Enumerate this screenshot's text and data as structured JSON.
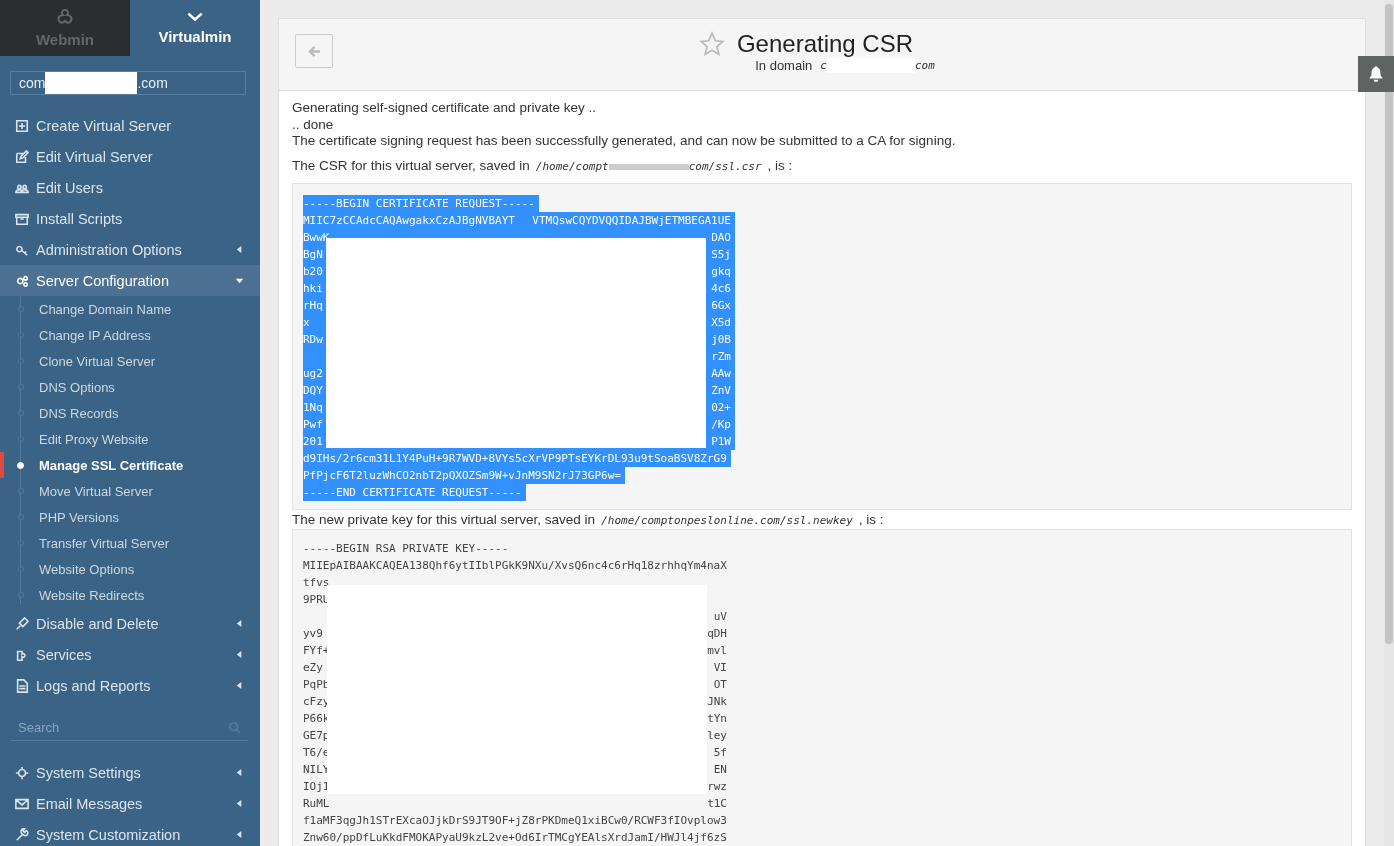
{
  "sidebar": {
    "tabs": [
      {
        "label": "Webmin",
        "selected": false
      },
      {
        "label": "Virtualmin",
        "selected": true
      }
    ],
    "domain": {
      "start": "com",
      "end": ".com"
    },
    "menu": [
      {
        "label": "Create Virtual Server"
      },
      {
        "label": "Edit Virtual Server"
      },
      {
        "label": "Edit Users"
      },
      {
        "label": "Install Scripts"
      },
      {
        "label": "Administration Options",
        "expanded": false
      },
      {
        "label": "Server Configuration",
        "expanded": true,
        "children": [
          {
            "label": "Change Domain Name",
            "selected": false
          },
          {
            "label": "Change IP Address",
            "selected": false
          },
          {
            "label": "Clone Virtual Server",
            "selected": false
          },
          {
            "label": "DNS Options",
            "selected": false
          },
          {
            "label": "DNS Records",
            "selected": false
          },
          {
            "label": "Edit Proxy Website",
            "selected": false
          },
          {
            "label": "Manage SSL Certificate",
            "selected": true
          },
          {
            "label": "Move Virtual Server",
            "selected": false
          },
          {
            "label": "PHP Versions",
            "selected": false
          },
          {
            "label": "Transfer Virtual Server",
            "selected": false
          },
          {
            "label": "Website Options",
            "selected": false
          },
          {
            "label": "Website Redirects",
            "selected": false
          }
        ]
      },
      {
        "label": "Disable and Delete",
        "expanded": false
      },
      {
        "label": "Services",
        "expanded": false
      },
      {
        "label": "Logs and Reports",
        "expanded": false
      }
    ],
    "search": {
      "placeholder": "Search"
    },
    "menu2": [
      {
        "label": "System Settings",
        "expanded": false
      },
      {
        "label": "Email Messages",
        "expanded": false
      },
      {
        "label": "System Customization",
        "expanded": false
      }
    ]
  },
  "header": {
    "title": "Generating CSR",
    "subtitle": "In domain",
    "domain": {
      "start": "c",
      "end": "com"
    }
  },
  "messages": [
    "Generating self-signed certificate and private key ..",
    ".. done",
    "The certificate signing request has been successfully generated, and can now be submitted to a CA for signing."
  ],
  "csr": {
    "intro": "The CSR for this virtual server, saved in",
    "path_start": "/home/compt",
    "path_end": "com/ssl.csr",
    "suffix": ", is :",
    "lines": [
      {
        "start": "-----BEGIN CERTIFICATE REQUEST-----"
      },
      {
        "start": "MIIC7zCCAdcCAQAwgakxCzAJBgNVBAYT",
        "end": "VTMQswCQYDVQQIDAJBWjETMBEGA1UE"
      },
      {
        "start": "BwwK",
        "end": "DAO"
      },
      {
        "start": "BgN",
        "end": "S5j"
      },
      {
        "start": "b20",
        "end": "gkq"
      },
      {
        "start": "hki",
        "end": "4c6"
      },
      {
        "start": "rHq",
        "end": "6Gx"
      },
      {
        "start": "x",
        "end": "X5d"
      },
      {
        "start": "RDw",
        "end": "j0B"
      },
      {
        "end": "rZm"
      },
      {
        "start": "ug2",
        "end": "AAw"
      },
      {
        "start": "DQY",
        "end": "ZnV"
      },
      {
        "start": "1Nq",
        "end": "02+"
      },
      {
        "start": "Pwf",
        "end": "/Kp"
      },
      {
        "start": "201",
        "end": "P1W"
      },
      {
        "start": "d9IHs/2r6cm31L1Y4PuH+9R7WVD+8VYs5cXrVP9PTsEYKrDL93u9tSoaBSV8ZrG9"
      },
      {
        "start": "PfPjcF6T2luzWhCO2nbT2pQXOZSm9W+vJnM9SN2rJ73GP6w="
      },
      {
        "start": "-----END CERTIFICATE REQUEST-----"
      }
    ]
  },
  "key": {
    "intro": "The new private key for this virtual server, saved in",
    "path": "/home/comptonpeslonline.com/ssl.newkey",
    "suffix": ", is :",
    "lines": [
      {
        "start": "-----BEGIN RSA PRIVATE KEY-----"
      },
      {
        "start": "MIIEpAIBAAKCAQEA138Qhf6ytIIblPGkK9NXu/XvsQ6nc4c6rHq18zrhhqYm4naX"
      },
      {
        "start": "tfvs"
      },
      {
        "start": "9PRU"
      },
      {
        "end": "uV"
      },
      {
        "start": "yv9",
        "end": "qDH"
      },
      {
        "start": "FYf+",
        "end": "mvl"
      },
      {
        "start": "eZy",
        "end": "VI"
      },
      {
        "start": "PqPb",
        "end": "OT"
      },
      {
        "start": "cFzy",
        "end": "JNk"
      },
      {
        "start": "P66k",
        "end": "tYn"
      },
      {
        "start": "GE7p",
        "end": "ley"
      },
      {
        "start": "T6/e",
        "end": "5f"
      },
      {
        "start": "NILY",
        "end": "EN"
      },
      {
        "start": "IOj1",
        "end": "rwz"
      },
      {
        "start": "RuML",
        "end": "t1C"
      },
      {
        "start": "f1aMF3qgJh1STrEXcaOJjkDrS9JT9OF+jZ8rPKDmeQ1xiBCw0/RCWF3fIOvplow3"
      },
      {
        "start": "Znw60/ppDfLuKkdFMOKAPyaU9kzL2ve+Od6IrTMCgYEAlsXrdJamI/HWJl4jf6zS"
      }
    ]
  }
}
